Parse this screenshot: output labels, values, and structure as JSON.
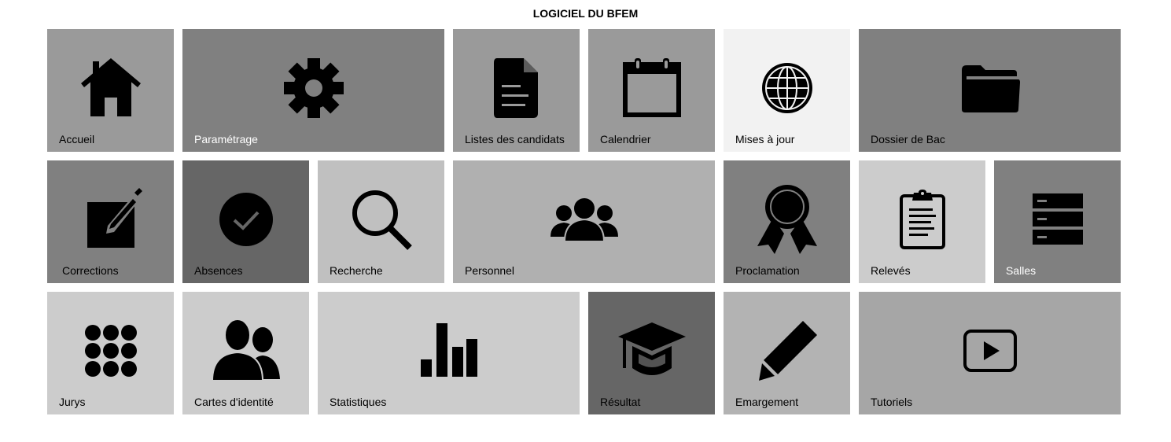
{
  "app_title": "LOGICIEL DU BFEM",
  "tiles": {
    "accueil": {
      "label": "Accueil",
      "bg": "#9a9a9a",
      "fg": "#000000",
      "icon": "home-icon"
    },
    "parametrage": {
      "label": "Paramétrage",
      "bg": "#808080",
      "fg": "#ffffff",
      "icon": "gear-icon"
    },
    "listes": {
      "label": "Listes des candidats",
      "bg": "#9a9a9a",
      "fg": "#000000",
      "icon": "document-icon"
    },
    "calendrier": {
      "label": "Calendrier",
      "bg": "#9a9a9a",
      "fg": "#000000",
      "icon": "calendar-icon"
    },
    "mises_a_jour": {
      "label": "Mises à jour",
      "bg": "#f2f2f2",
      "fg": "#000000",
      "icon": "globe-icon"
    },
    "dossier_bac": {
      "label": "Dossier de Bac",
      "bg": "#808080",
      "fg": "#000000",
      "icon": "folder-icon"
    },
    "corrections": {
      "label": "Corrections",
      "bg": "#808080",
      "fg": "#000000",
      "icon": "edit-icon"
    },
    "absences": {
      "label": "Absences",
      "bg": "#666666",
      "fg": "#000000",
      "icon": "check-circle-icon"
    },
    "recherche": {
      "label": "Recherche",
      "bg": "#c0c0c0",
      "fg": "#000000",
      "icon": "search-icon"
    },
    "personnel": {
      "label": "Personnel",
      "bg": "#b0b0b0",
      "fg": "#000000",
      "icon": "users-icon"
    },
    "proclamation": {
      "label": "Proclamation",
      "bg": "#808080",
      "fg": "#000000",
      "icon": "award-icon"
    },
    "releves": {
      "label": "Relevés",
      "bg": "#cccccc",
      "fg": "#000000",
      "icon": "clipboard-icon"
    },
    "salles": {
      "label": "Salles",
      "bg": "#808080",
      "fg": "#ffffff",
      "icon": "server-icon"
    },
    "jurys": {
      "label": "Jurys",
      "bg": "#cccccc",
      "fg": "#000000",
      "icon": "dots-grid-icon"
    },
    "cartes": {
      "label": "Cartes d'identité",
      "bg": "#cccccc",
      "fg": "#000000",
      "icon": "id-people-icon"
    },
    "statistiques": {
      "label": "Statistiques",
      "bg": "#cccccc",
      "fg": "#000000",
      "icon": "bar-chart-icon"
    },
    "resultat": {
      "label": "Résultat",
      "bg": "#666666",
      "fg": "#000000",
      "icon": "graduation-cap-icon"
    },
    "emargement": {
      "label": "Emargement",
      "bg": "#b3b3b3",
      "fg": "#000000",
      "icon": "pencil-icon"
    },
    "tutoriels": {
      "label": "Tutoriels",
      "bg": "#a6a6a6",
      "fg": "#000000",
      "icon": "play-video-icon"
    }
  }
}
